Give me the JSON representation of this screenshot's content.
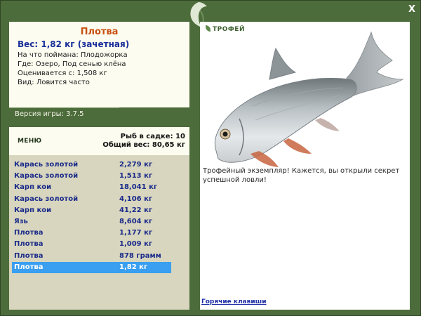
{
  "fish": {
    "name": "Плотва",
    "weight_line": "Вес: 1,82 кг (зачетная)",
    "bait": "На что поймана: Плодожорка",
    "location": "Где: Озеро, Под сенью клёна",
    "value": "Оценивается с: 1,508 кг",
    "kind": "Вид: Ловится часто"
  },
  "version": "Версия игры: 3.7.5",
  "menu_label": "МЕНЮ",
  "stats": {
    "count": "Рыб в садке: 10",
    "total": "Общий вес: 80,65 кг"
  },
  "catches": [
    {
      "name": "Карась золотой",
      "weight": "2,279 кг"
    },
    {
      "name": "Карась золотой",
      "weight": "1,513 кг"
    },
    {
      "name": "Карп кои",
      "weight": "18,041 кг"
    },
    {
      "name": "Карась золотой",
      "weight": "4,106 кг"
    },
    {
      "name": "Карп кои",
      "weight": "41,22 кг"
    },
    {
      "name": "Язь",
      "weight": "8,604 кг"
    },
    {
      "name": "Плотва",
      "weight": "1,177 кг"
    },
    {
      "name": "Плотва",
      "weight": "1,009 кг"
    },
    {
      "name": "Плотва",
      "weight": "878 грамм"
    },
    {
      "name": "Плотва",
      "weight": "1,82 кг"
    }
  ],
  "selected_index": 9,
  "trophy": {
    "label": "ТРОФЕЙ",
    "text": "Трофейный экземпляр! Кажется, вы открыли секрет успешной ловли!"
  },
  "hotkeys_label": "Горячие клавиши",
  "close_label": "X",
  "colors": {
    "frame": "#4d6c3b",
    "panel": "#fcfcf0",
    "list_bg": "#d8d6be",
    "accent_title": "#c8500f",
    "link": "#1d2da6",
    "selection": "#3a9ff0"
  }
}
